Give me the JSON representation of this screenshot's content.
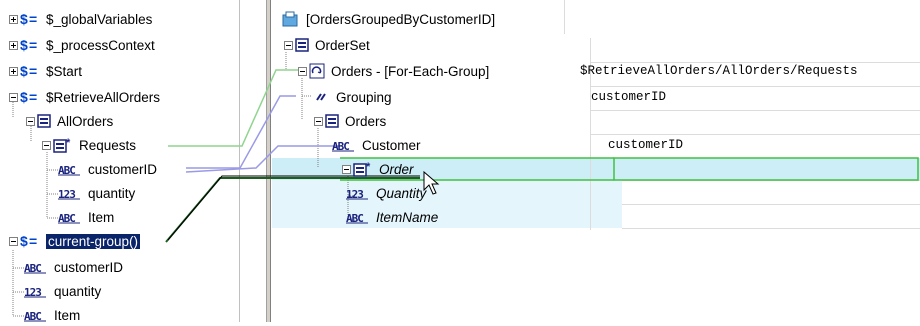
{
  "source_tree": {
    "nodes": [
      {
        "id": "globalVariables",
        "label": "$_globalVariables",
        "icon": "dollar-equals-icon",
        "expander": "plus"
      },
      {
        "id": "processContext",
        "label": "$_processContext",
        "icon": "dollar-equals-icon",
        "expander": "plus"
      },
      {
        "id": "start",
        "label": "$Start",
        "icon": "dollar-equals-icon",
        "expander": "plus"
      },
      {
        "id": "retrieveAllOrders",
        "label": "$RetrieveAllOrders",
        "icon": "dollar-equals-icon",
        "expander": "minus"
      },
      {
        "id": "allOrders",
        "label": "AllOrders",
        "icon": "complex-element-icon",
        "expander": "minus"
      },
      {
        "id": "requests",
        "label": "Requests",
        "icon": "repeating-element-icon",
        "expander": "minus"
      },
      {
        "id": "customerID",
        "label": "customerID",
        "icon": "string-type-icon"
      },
      {
        "id": "quantity",
        "label": "quantity",
        "icon": "integer-type-icon"
      },
      {
        "id": "item",
        "label": "Item",
        "icon": "string-type-icon"
      },
      {
        "id": "currentGroup",
        "label": "current-group()",
        "icon": "dollar-equals-icon",
        "expander": "minus",
        "selected": true
      },
      {
        "id": "cgCustomerID",
        "label": "customerID",
        "icon": "string-type-icon"
      },
      {
        "id": "cgQuantity",
        "label": "quantity",
        "icon": "integer-type-icon"
      },
      {
        "id": "cgItem",
        "label": "Item",
        "icon": "string-type-icon"
      }
    ]
  },
  "target_tree": {
    "nodes": [
      {
        "id": "root",
        "label": "[OrdersGroupedByCustomerID]",
        "icon": "schema-root-icon",
        "value": ""
      },
      {
        "id": "orderSet",
        "label": "OrderSet",
        "icon": "complex-element-icon",
        "expander": "minus",
        "value": ""
      },
      {
        "id": "orders",
        "label": "Orders - [For-Each-Group]",
        "icon": "for-each-group-icon",
        "expander": "minus",
        "value": "$RetrieveAllOrders/AllOrders/Requests"
      },
      {
        "id": "grouping",
        "label": "Grouping",
        "icon": "grouping-icon",
        "value": "customerID"
      },
      {
        "id": "ordersEl",
        "label": "Orders",
        "icon": "complex-element-icon",
        "expander": "minus",
        "value": ""
      },
      {
        "id": "customer",
        "label": "Customer",
        "icon": "string-type-icon",
        "value": "customerID"
      },
      {
        "id": "order",
        "label": "Order",
        "icon": "repeating-element-icon",
        "expander": "minus",
        "italic": true,
        "value": ""
      },
      {
        "id": "quantity",
        "label": "Quantity",
        "icon": "integer-type-icon",
        "italic": true,
        "value": ""
      },
      {
        "id": "itemName",
        "label": "ItemName",
        "icon": "string-type-icon",
        "italic": true,
        "value": ""
      }
    ]
  },
  "colors": {
    "selection_bg": "#0a246a",
    "mapping_line": "#9a9ae6",
    "mapping_line_green": "#8fd48f",
    "drag_line": "#1b5e20",
    "highlight_row": "#e4f5fb",
    "icon_dollar": "#0044cc",
    "icon_abc": "#1a237e"
  }
}
